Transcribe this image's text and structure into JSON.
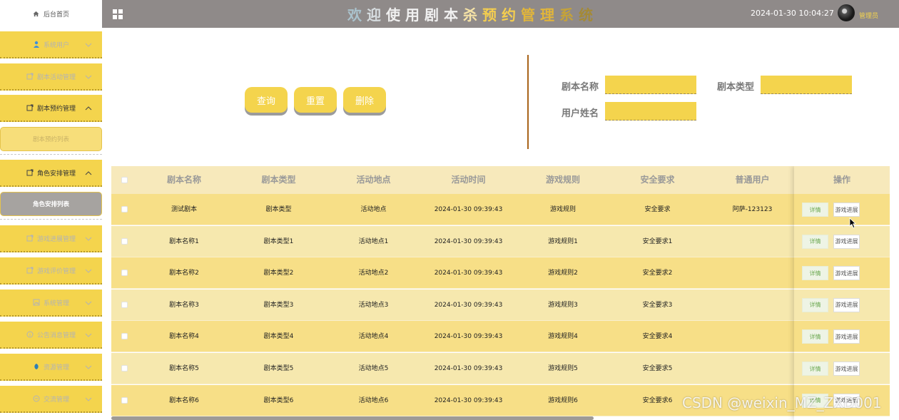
{
  "sidebar": {
    "home": "后台首页",
    "menus": [
      {
        "label": "系统用户",
        "icon": "user-icon"
      },
      {
        "label": "剧本活动管理",
        "icon": "folder-icon"
      },
      {
        "label": "剧本预约管理",
        "icon": "folder-icon",
        "open": true
      },
      {
        "label": "角色安排管理",
        "icon": "folder-icon",
        "open": true
      },
      {
        "label": "游戏进展管理",
        "icon": "folder-icon"
      },
      {
        "label": "游戏评价管理",
        "icon": "folder-icon"
      },
      {
        "label": "系统管理",
        "icon": "image-icon"
      },
      {
        "label": "公告消息管理",
        "icon": "info-icon"
      },
      {
        "label": "资源管理",
        "icon": "leaf-icon"
      },
      {
        "label": "交流管理",
        "icon": "chat-icon"
      }
    ],
    "subs": {
      "booking_list": "剧本预约列表",
      "role_list": "角色安排列表"
    }
  },
  "topbar": {
    "title_chars": [
      "欢",
      "迎",
      "使",
      "用",
      "剧",
      "本",
      "杀",
      "预",
      "约",
      "管",
      "理",
      "系",
      "统"
    ],
    "datetime": "2024-01-30 10:04:27",
    "user": "管理员"
  },
  "search": {
    "query_label": "查询",
    "reset_label": "重置",
    "delete_label": "删除",
    "fields": {
      "script_name": {
        "label": "剧本名称",
        "value": ""
      },
      "script_type": {
        "label": "剧本类型",
        "value": ""
      },
      "user_name": {
        "label": "用户姓名",
        "value": ""
      }
    }
  },
  "table": {
    "columns": [
      "剧本名称",
      "剧本类型",
      "活动地点",
      "活动时间",
      "游戏规则",
      "安全要求",
      "普通用户",
      "操作"
    ],
    "rows": [
      [
        "测试剧本",
        "剧本类型",
        "活动地点",
        "2024-01-30 09:39:43",
        "游戏规则",
        "安全要求",
        "阿萨-123123"
      ],
      [
        "剧本名称1",
        "剧本类型1",
        "活动地点1",
        "2024-01-30 09:39:43",
        "游戏规则1",
        "安全要求1",
        ""
      ],
      [
        "剧本名称2",
        "剧本类型2",
        "活动地点2",
        "2024-01-30 09:39:43",
        "游戏规则2",
        "安全要求2",
        ""
      ],
      [
        "剧本名称3",
        "剧本类型3",
        "活动地点3",
        "2024-01-30 09:39:43",
        "游戏规则3",
        "安全要求3",
        ""
      ],
      [
        "剧本名称4",
        "剧本类型4",
        "活动地点4",
        "2024-01-30 09:39:43",
        "游戏规则4",
        "安全要求4",
        ""
      ],
      [
        "剧本名称5",
        "剧本类型5",
        "活动地点5",
        "2024-01-30 09:39:43",
        "游戏规则5",
        "安全要求5",
        ""
      ],
      [
        "剧本名称6",
        "剧本类型6",
        "活动地点6",
        "2024-01-30 09:39:43",
        "游戏规则6",
        "安全要求6",
        ""
      ]
    ],
    "detail_label": "详情",
    "progress_label": "游戏进展"
  },
  "watermark": "CSDN @weixin_MZ_ZXD001",
  "colors": {
    "accent": "#f4d44d",
    "topbar": "#8f8a89",
    "active_sub": "#a6a3a0"
  }
}
